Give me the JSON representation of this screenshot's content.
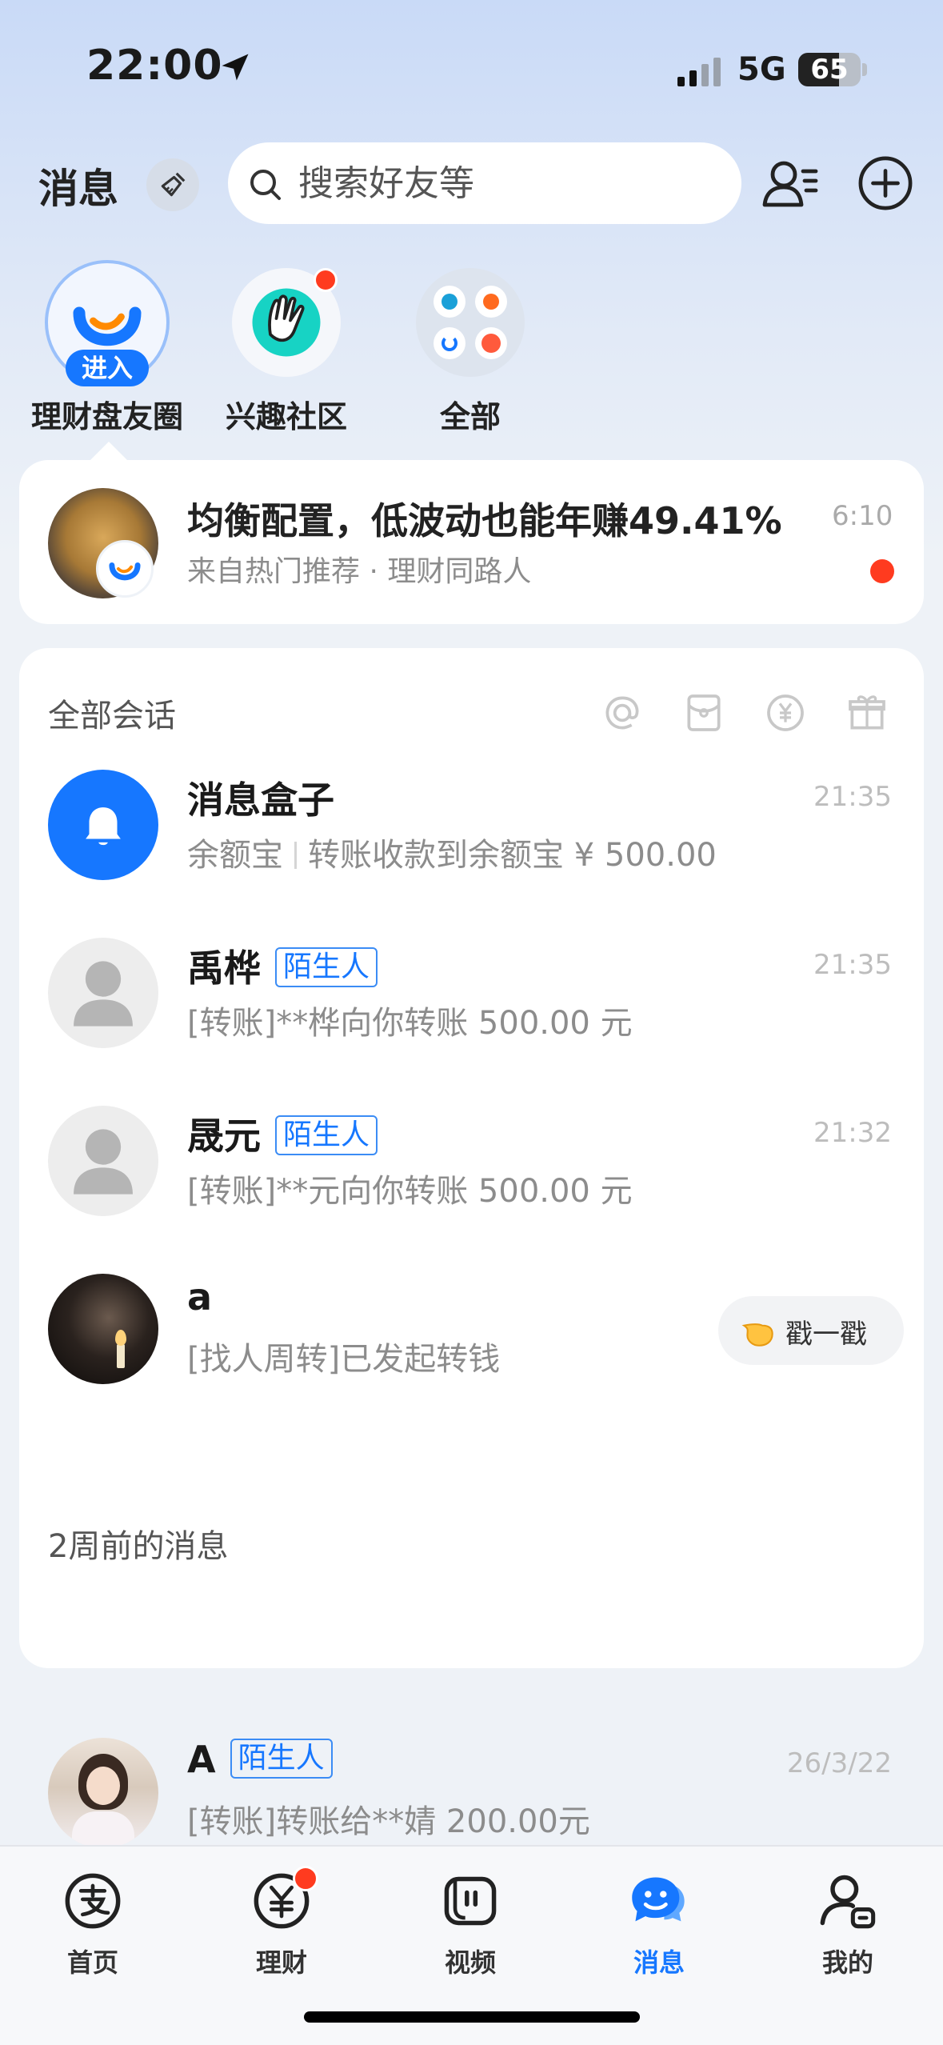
{
  "status_bar": {
    "time": "22:00",
    "network": "5G",
    "battery": "65",
    "battery_level": 0.65
  },
  "header": {
    "title": "消息",
    "search_placeholder": "搜索好友等"
  },
  "shortcuts": [
    {
      "label": "理财盘友圈",
      "badge": "进入"
    },
    {
      "label": "兴趣社区"
    },
    {
      "label": "全部"
    }
  ],
  "promo": {
    "title": "均衡配置，低波动也能年赚49.41%",
    "subtitle": "来自热门推荐 · 理财同路人",
    "time": "6:10"
  },
  "conversations": {
    "section_title": "全部会话",
    "items": [
      {
        "name": "消息盒子",
        "source": "余额宝",
        "preview": "转账收款到余额宝 ¥ 500.00",
        "time": "21:35"
      },
      {
        "name": "禹桦",
        "tag": "陌生人",
        "preview": "[转账]**桦向你转账 500.00 元",
        "time": "21:35"
      },
      {
        "name": "晟元",
        "tag": "陌生人",
        "preview": "[转账]**元向你转账 500.00 元",
        "time": "21:32"
      },
      {
        "name": "a",
        "preview": "[找人周转]已发起转钱",
        "action": "戳一戳"
      }
    ],
    "older_section_title": "2周前的消息",
    "older_items": [
      {
        "name": "A",
        "tag": "陌生人",
        "preview": "[转账]转账给**婧 200.00元",
        "time": "26/3/22"
      }
    ]
  },
  "tab_bar": {
    "tabs": [
      {
        "label": "首页",
        "icon": "alipay-icon"
      },
      {
        "label": "理财",
        "icon": "yuan-icon"
      },
      {
        "label": "视频",
        "icon": "video-icon"
      },
      {
        "label": "消息",
        "icon": "chat-icon",
        "active": true
      },
      {
        "label": "我的",
        "icon": "profile-icon"
      }
    ]
  },
  "colors": {
    "accent": "#1677ff",
    "badge_red": "#ff3b1f"
  }
}
